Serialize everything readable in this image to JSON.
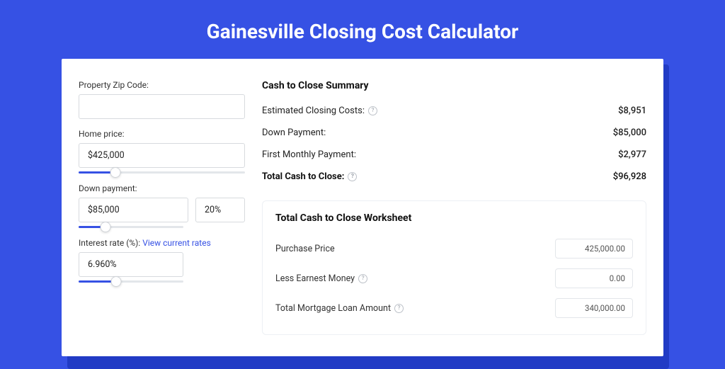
{
  "title": "Gainesville Closing Cost Calculator",
  "form": {
    "zip": {
      "label": "Property Zip Code:",
      "value": ""
    },
    "home_price": {
      "label": "Home price:",
      "value": "$425,000",
      "slider_percent": 22
    },
    "down_payment": {
      "label": "Down payment:",
      "value": "$85,000",
      "percent": "20%",
      "slider_percent": 26
    },
    "interest_rate": {
      "label": "Interest rate (%):",
      "link_text": "View current rates",
      "value": "6.960%",
      "slider_percent": 36
    }
  },
  "summary": {
    "title": "Cash to Close Summary",
    "rows": [
      {
        "label": "Estimated Closing Costs:",
        "help": true,
        "value": "$8,951",
        "bold": false
      },
      {
        "label": "Down Payment:",
        "help": false,
        "value": "$85,000",
        "bold": false
      },
      {
        "label": "First Monthly Payment:",
        "help": false,
        "value": "$2,977",
        "bold": false
      },
      {
        "label": "Total Cash to Close:",
        "help": true,
        "value": "$96,928",
        "bold": true
      }
    ]
  },
  "worksheet": {
    "title": "Total Cash to Close Worksheet",
    "rows": [
      {
        "label": "Purchase Price",
        "help": false,
        "value": "425,000.00"
      },
      {
        "label": "Less Earnest Money",
        "help": true,
        "value": "0.00"
      },
      {
        "label": "Total Mortgage Loan Amount",
        "help": true,
        "value": "340,000.00"
      }
    ]
  }
}
